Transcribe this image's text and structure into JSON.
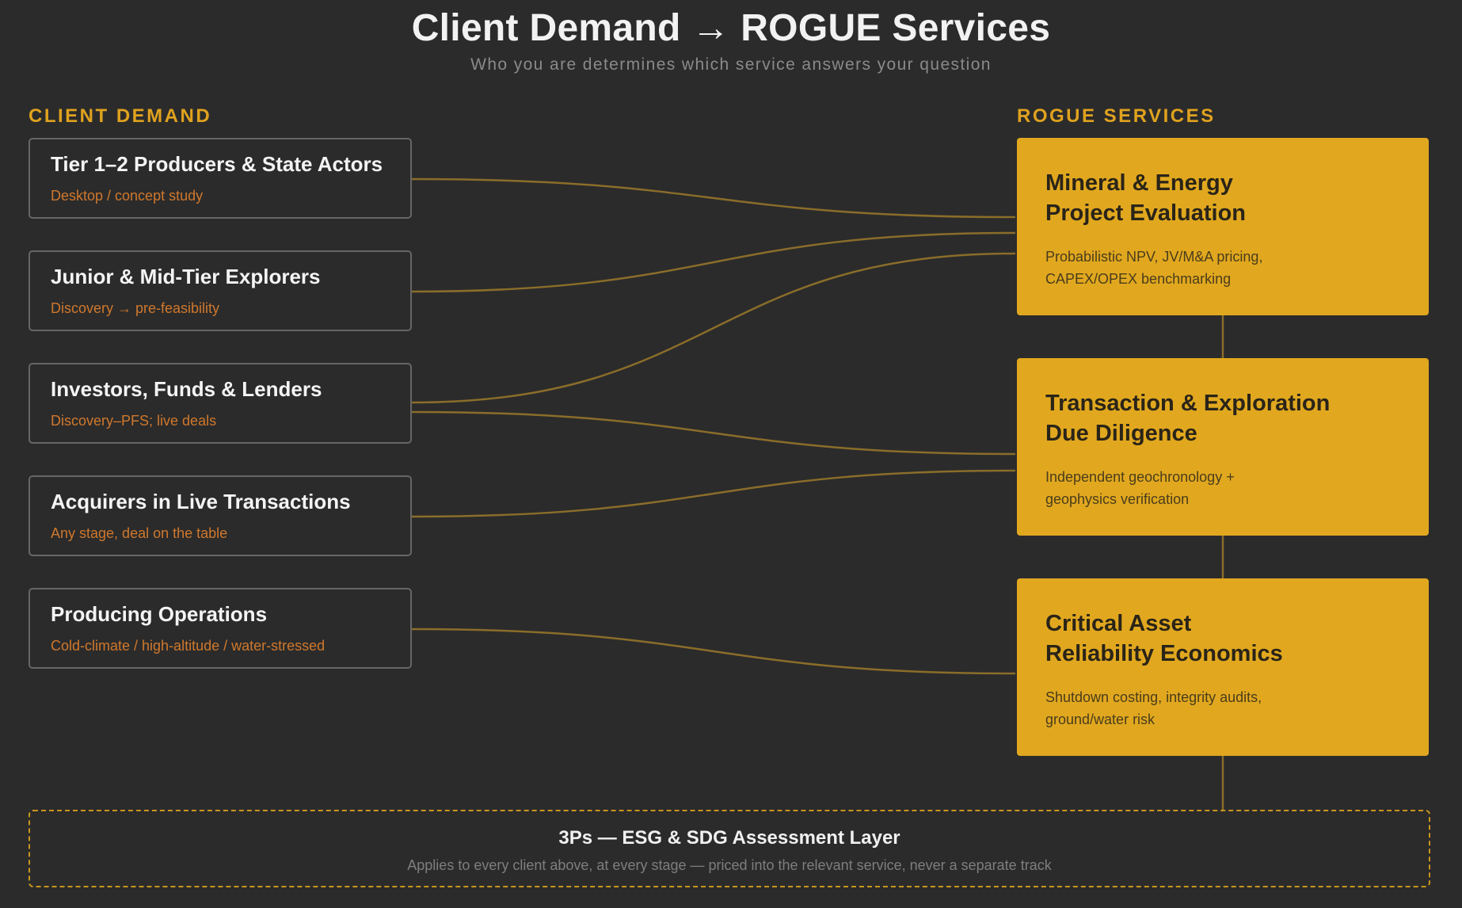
{
  "header": {
    "title": "Client Demand → ROGUE Services",
    "subtitle": "Who you are determines which service answers your question"
  },
  "left_label": "CLIENT DEMAND",
  "right_label": "ROGUE SERVICES",
  "clients": [
    {
      "name": "Tier 1–2 Producers & State Actors",
      "sub": "Desktop / concept study"
    },
    {
      "name": "Junior & Mid-Tier Explorers",
      "sub": "Discovery → pre-feasibility"
    },
    {
      "name": "Investors, Funds & Lenders",
      "sub": "Discovery–PFS; live deals"
    },
    {
      "name": "Acquirers in Live Transactions",
      "sub": "Any stage, deal on the table"
    },
    {
      "name": "Producing Operations",
      "sub": "Cold-climate / high-altitude / water-stressed"
    }
  ],
  "services": [
    {
      "line1": "Mineral & Energy",
      "line2": "Project Evaluation",
      "desc_line1": "Probabilistic NPV, JV/M&A pricing,",
      "desc_line2": "CAPEX/OPEX benchmarking"
    },
    {
      "line1": "Transaction & Exploration",
      "line2": "Due Diligence",
      "desc_line1": "Independent geochronology +",
      "desc_line2": "geophysics verification"
    },
    {
      "line1": "Critical Asset",
      "line2": "Reliability Economics",
      "desc_line1": "Shutdown costing, integrity audits,",
      "desc_line2": "ground/water risk"
    }
  ],
  "links": [
    {
      "from": 0,
      "to": 0
    },
    {
      "from": 1,
      "to": 0
    },
    {
      "from": 2,
      "to": 0
    },
    {
      "from": 2,
      "to": 1
    },
    {
      "from": 3,
      "to": 1
    },
    {
      "from": 4,
      "to": 2
    }
  ],
  "esg": {
    "title": "3Ps — ESG & SDG Assessment Layer",
    "subtitle": "Applies to every client above, at every stage — priced into the relevant service, never a separate track"
  },
  "colors": {
    "background": "#2b2b2b",
    "accent": "#e1a81f",
    "connector": "#8a6d2a",
    "client_sub": "#d0782c"
  }
}
